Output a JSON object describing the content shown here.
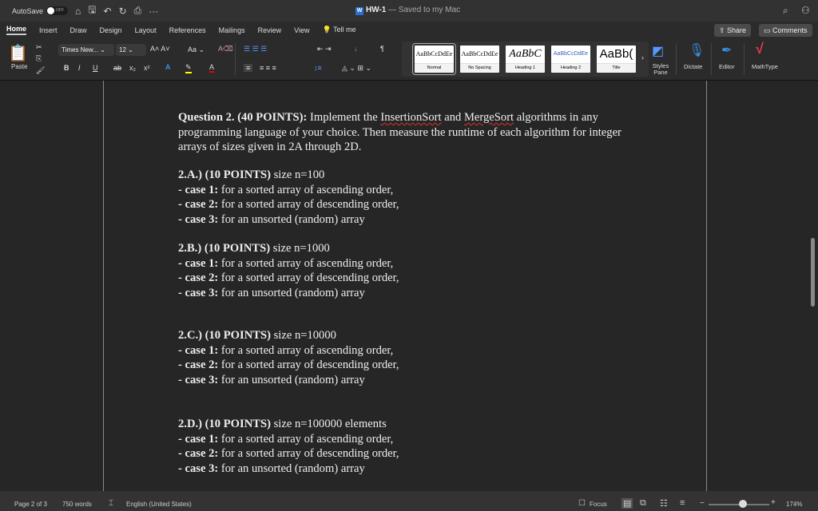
{
  "titlebar": {
    "autosave": "AutoSave",
    "toggle": "OFF",
    "doc_title": "HW-1",
    "doc_status": "— Saved to my Mac"
  },
  "tabs": [
    "Home",
    "Insert",
    "Draw",
    "Design",
    "Layout",
    "References",
    "Mailings",
    "Review",
    "View",
    "Tell me"
  ],
  "share": "Share",
  "comments": "Comments",
  "ribbon": {
    "paste": "Paste",
    "font": "Times New...",
    "size": "12",
    "case": "Aa",
    "styles": [
      {
        "preview": "AaBbCcDdEe",
        "name": "Normal"
      },
      {
        "preview": "AaBbCcDdEe",
        "name": "No Spacing"
      },
      {
        "preview": "AaBbC",
        "name": "Heading 1"
      },
      {
        "preview": "AaBbCcDdEe",
        "name": "Heading 2"
      },
      {
        "preview": "AaBb(",
        "name": "Title"
      }
    ],
    "styles_pane": "Styles Pane",
    "dictate": "Dictate",
    "editor": "Editor",
    "mathtype": "MathType"
  },
  "doc": {
    "intro_bold": "Question 2. (40 POINTS):",
    "intro_1a": " Implement the ",
    "insertion": "InsertionSort",
    "intro_1b": " and ",
    "merge": "MergeSort",
    "intro_1c": " algorithms in any",
    "intro_2": "programming language of your choice. Then measure the runtime of each algorithm for integer",
    "intro_3": "arrays of sizes given in 2A through 2D.",
    "sections": [
      {
        "head": "2.A.) (10 POINTS)",
        "size": " size n=100"
      },
      {
        "head": "2.B.) (10 POINTS)",
        "size": " size n=1000"
      },
      {
        "head": "2.C.) (10 POINTS)",
        "size": " size n=10000"
      },
      {
        "head": "2.D.) (10 POINTS)",
        "size": " size n=100000 elements"
      }
    ],
    "cases": [
      {
        "label": "- case 1:",
        "text": " for a sorted array of ascending order,"
      },
      {
        "label": "- case 2:",
        "text": " for a sorted array of descending order,"
      },
      {
        "label": "- case 3:",
        "text": " for an unsorted (random) array"
      }
    ]
  },
  "status": {
    "page": "Page 2 of 3",
    "words": "750 words",
    "language": "English (United States)",
    "focus": "Focus",
    "zoom": "174%"
  }
}
